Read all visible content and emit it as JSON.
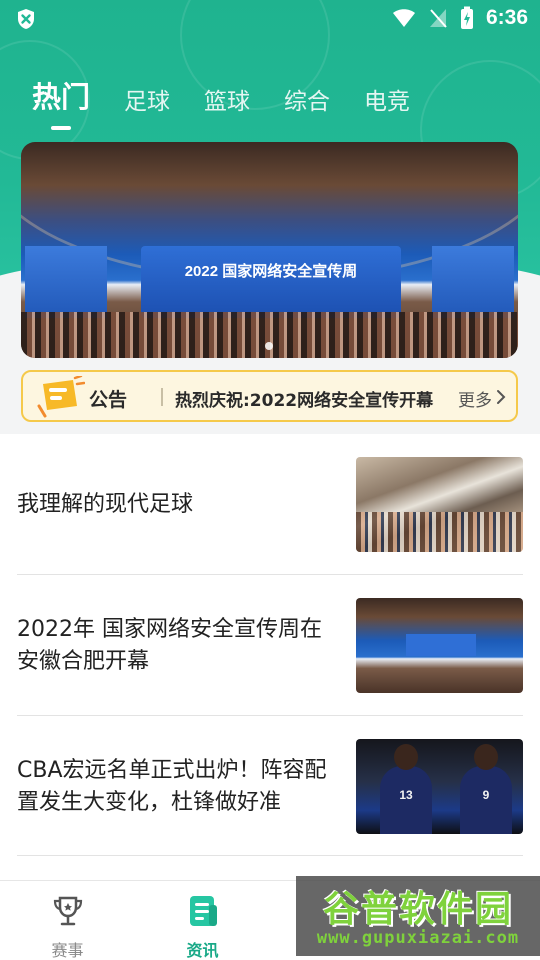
{
  "status_bar": {
    "time": "6:36"
  },
  "tabs": [
    {
      "label": "热门",
      "active": true
    },
    {
      "label": "足球",
      "active": false
    },
    {
      "label": "篮球",
      "active": false
    },
    {
      "label": "综合",
      "active": false
    },
    {
      "label": "电竞",
      "active": false
    }
  ],
  "banner": {
    "screen_text": "2022 国家网络安全宣传周"
  },
  "notice": {
    "label": "公告",
    "text": "热烈庆祝:2022网络安全宣传开幕",
    "more": "更多"
  },
  "articles": [
    {
      "title": "我理解的现代足球"
    },
    {
      "title": "2022年 国家网络安全宣传周在安徽合肥开幕"
    },
    {
      "title": "CBA宏远名单正式出炉！阵容配置发生大变化，杜锋做好准",
      "jersey_numbers": [
        "13",
        "9"
      ]
    }
  ],
  "bottom_nav": [
    {
      "label": "赛事",
      "icon": "trophy-icon",
      "active": false
    },
    {
      "label": "资讯",
      "icon": "news-icon",
      "active": true
    }
  ],
  "watermark": {
    "title": "谷普软件园",
    "url": "www.gupuxiazai.com"
  },
  "colors": {
    "accent": "#1aa988",
    "hero": "#22b996",
    "notice_border": "#f5c94a"
  }
}
